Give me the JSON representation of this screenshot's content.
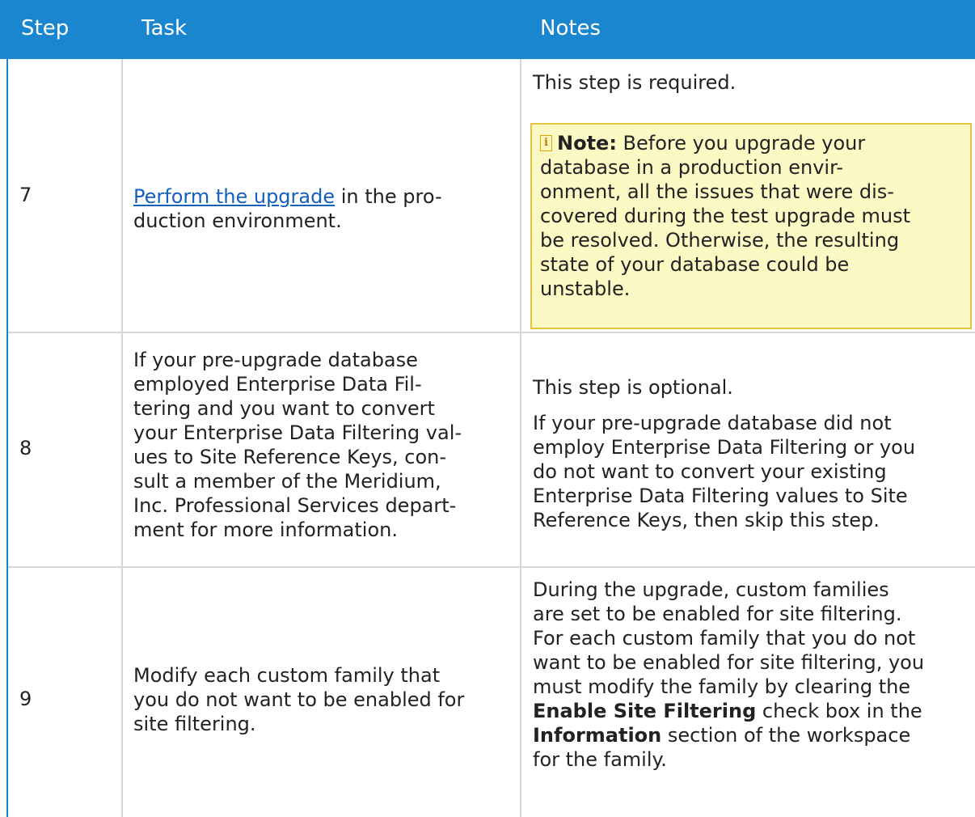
{
  "table": {
    "headers": {
      "step": "Step",
      "task": "Task",
      "notes": "Notes"
    },
    "rows": [
      {
        "step": "7",
        "task_link": "Perform the upgrade",
        "task_rest": " in the pro-",
        "task_line2": "duction environment.",
        "note_intro": "This step is required.",
        "note_box": {
          "icon": "note-icon",
          "label": "Note:",
          "lines": [
            " Before you upgrade your",
            "database in a production envir-",
            "onment, all the issues that were dis-",
            "covered during the test upgrade must",
            "be resolved. Otherwise, the resulting",
            "state of your database could be",
            "unstable."
          ]
        }
      },
      {
        "step": "8",
        "task_lines": [
          "If your pre-upgrade database",
          "employed Enterprise Data Fil-",
          "tering and you want to convert",
          "your Enterprise Data Filtering val-",
          "ues to Site Reference Keys, con-",
          "sult a member of the Meridium,",
          "Inc. Professional Services depart-",
          "ment for more information."
        ],
        "note_intro": "This step is optional.",
        "note_lines": [
          "If your pre-upgrade database did not",
          "employ Enterprise Data Filtering or you",
          "do not want to convert your existing",
          "Enterprise Data Filtering values to Site",
          "Reference Keys, then skip this step."
        ]
      },
      {
        "step": "9",
        "task_lines": [
          "Modify each custom family that",
          "you do not want to be enabled for",
          "site filtering."
        ],
        "note_lines": [
          "During the upgrade, custom families",
          "are set to be enabled for site filtering.",
          "For each custom family that you do not",
          "want to be enabled for site filtering, you",
          "must modify the family by clearing the"
        ],
        "note_term1": "Enable Site Filtering",
        "note_after_term1": " check box in the",
        "note_term2": "Information",
        "note_after_term2": " section of the workspace",
        "note_last": "for the family."
      }
    ]
  },
  "colors": {
    "header_bg": "#1a86d0",
    "header_text": "#ffffff",
    "link": "#1560bd",
    "note_bg": "#fdf9c4",
    "note_border": "#e3c53f",
    "grid": "#d6d6d6"
  }
}
